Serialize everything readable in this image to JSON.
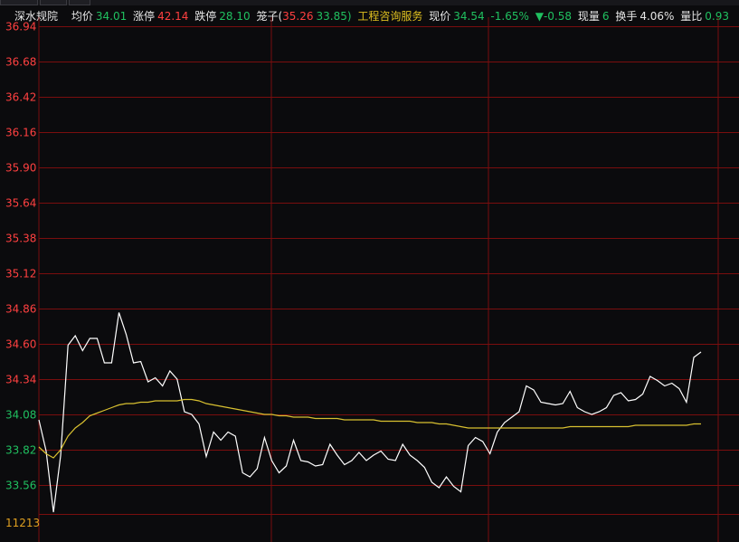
{
  "header": {
    "stock_name": "深水规院",
    "avg_label": "均价",
    "avg_value": "34.01",
    "limit_up_label": "涨停",
    "limit_up_value": "42.14",
    "limit_down_label": "跌停",
    "limit_down_value": "28.10",
    "cage_label": "笼子(",
    "cage_low": "35.26",
    "cage_high": "33.85)",
    "industry": "工程咨询服务",
    "price_label": "现价",
    "price_value": "34.54",
    "change_pct": "-1.65%",
    "change_arrow": "▼",
    "change_value": "-0.58",
    "volume_label": "现量",
    "volume_value": "6",
    "turnover_label": "换手",
    "turnover_value": "4.06%",
    "vol_ratio_label": "量比",
    "vol_ratio_value": "0.93"
  },
  "colors": {
    "background": "#0b0b0d",
    "grid": "#7a0e0e",
    "price_line": "#ffffff",
    "avg_line": "#d8c030",
    "up": "#ff4040",
    "down": "#20c060",
    "volume_label": "#e0a020"
  },
  "chart_data": {
    "type": "line",
    "y_ticks": [
      "36.94",
      "36.68",
      "36.42",
      "36.16",
      "35.90",
      "35.64",
      "35.38",
      "35.12",
      "34.86",
      "34.60",
      "34.34",
      "34.08",
      "33.82",
      "33.56"
    ],
    "y_tick_values": [
      36.94,
      36.68,
      36.42,
      36.16,
      35.9,
      35.64,
      35.38,
      35.12,
      34.86,
      34.6,
      34.34,
      34.08,
      33.82,
      33.56
    ],
    "ylim": [
      33.3,
      36.94
    ],
    "volume_label": "11213",
    "grid": true,
    "series": [
      {
        "key": "price",
        "values": [
          34.04,
          33.81,
          33.36,
          33.78,
          34.59,
          34.66,
          34.55,
          34.64,
          34.64,
          34.46,
          34.46,
          34.83,
          34.67,
          34.46,
          34.47,
          34.32,
          34.35,
          34.29,
          34.4,
          34.34,
          34.1,
          34.08,
          34.01,
          33.77,
          33.95,
          33.89,
          33.95,
          33.92,
          33.65,
          33.62,
          33.68,
          33.91,
          33.74,
          33.65,
          33.7,
          33.89,
          33.74,
          33.73,
          33.7,
          33.71,
          33.86,
          33.78,
          33.71,
          33.74,
          33.8,
          33.74,
          33.78,
          33.81,
          33.75,
          33.74,
          33.86,
          33.78,
          33.74,
          33.69,
          33.58,
          33.54,
          33.62,
          33.55,
          33.51,
          33.85,
          33.91,
          33.88,
          33.79,
          33.95,
          34.02,
          34.06,
          34.1,
          34.29,
          34.26,
          34.17,
          34.16,
          34.15,
          34.16,
          34.25,
          34.13,
          34.1,
          34.08,
          34.1,
          34.13,
          34.22,
          34.24,
          34.18,
          34.19,
          34.23,
          34.36,
          34.33,
          34.29,
          34.31,
          34.27,
          34.17,
          34.5,
          34.54
        ]
      },
      {
        "key": "average",
        "values": [
          33.84,
          33.79,
          33.76,
          33.82,
          33.92,
          33.98,
          34.02,
          34.07,
          34.09,
          34.11,
          34.13,
          34.15,
          34.16,
          34.16,
          34.17,
          34.17,
          34.18,
          34.18,
          34.18,
          34.18,
          34.19,
          34.19,
          34.18,
          34.16,
          34.15,
          34.14,
          34.13,
          34.12,
          34.11,
          34.1,
          34.09,
          34.08,
          34.08,
          34.07,
          34.07,
          34.06,
          34.06,
          34.06,
          34.05,
          34.05,
          34.05,
          34.05,
          34.04,
          34.04,
          34.04,
          34.04,
          34.04,
          34.03,
          34.03,
          34.03,
          34.03,
          34.03,
          34.02,
          34.02,
          34.02,
          34.01,
          34.01,
          34.0,
          33.99,
          33.98,
          33.98,
          33.98,
          33.98,
          33.98,
          33.98,
          33.98,
          33.98,
          33.98,
          33.98,
          33.98,
          33.98,
          33.98,
          33.98,
          33.99,
          33.99,
          33.99,
          33.99,
          33.99,
          33.99,
          33.99,
          33.99,
          33.99,
          34.0,
          34.0,
          34.0,
          34.0,
          34.0,
          34.0,
          34.0,
          34.0,
          34.01,
          34.01
        ]
      }
    ]
  }
}
